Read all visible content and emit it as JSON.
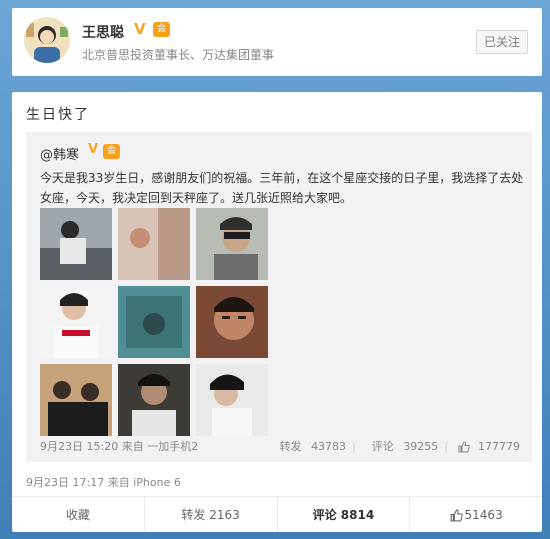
{
  "profile": {
    "name": "王思聪",
    "verified_badge": "V",
    "member_badge": "会",
    "title": "北京普思投资董事长、万达集团董事",
    "follow_button": "已关注"
  },
  "post": {
    "text": "生日快了",
    "repost": {
      "author": "@韩寒",
      "verified_badge": "V",
      "member_badge": "会",
      "text": "今天是我33岁生日，感谢朋友们的祝福。三年前，在这个星座交接的日子里，我选择了去处女座，今天，我决定回到天秤座了。送几张近照给大家吧。",
      "time": "9月23日 15:20",
      "source_prefix": "来自",
      "source": "一加手机2",
      "repost_label": "转发",
      "repost_count": "43783",
      "comment_label": "评论",
      "comment_count": "39255",
      "like_count": "177779"
    },
    "time": "9月23日 17:17",
    "source_prefix": "来自",
    "source": "iPhone 6"
  },
  "actions": {
    "favorite_label": "收藏",
    "repost_label": "转发",
    "repost_count": "2163",
    "comment_label": "评论",
    "comment_count": "8814",
    "like_count": "51463"
  },
  "colors": {
    "background": "#4f8fc4",
    "badge_gold": "#f5a623",
    "repost_bg": "#f2f2f5"
  }
}
